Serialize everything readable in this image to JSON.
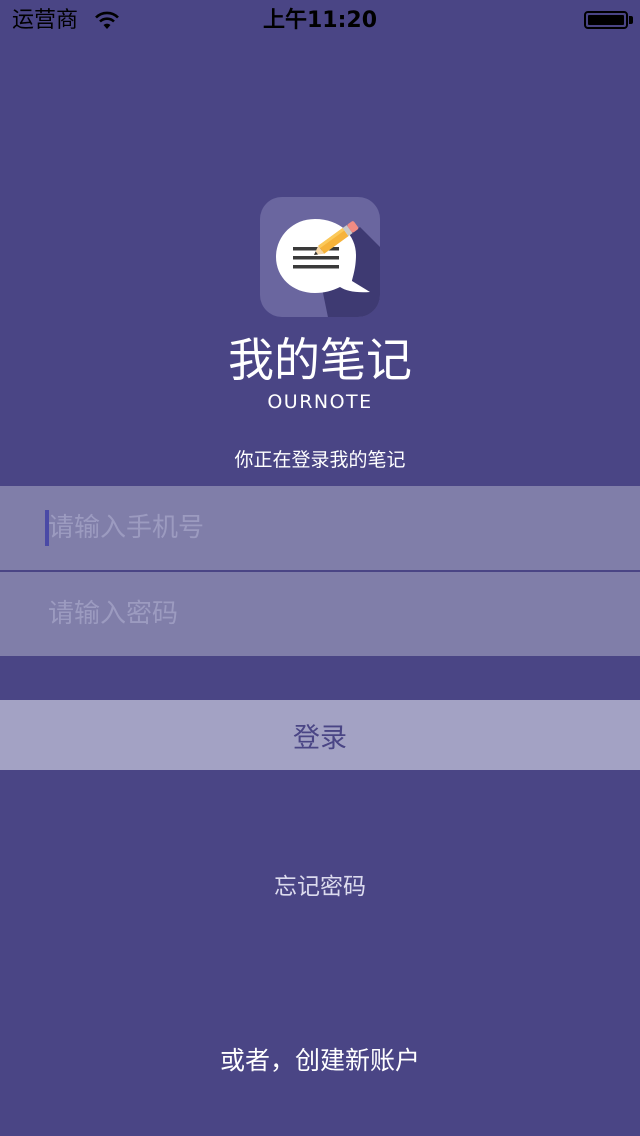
{
  "status_bar": {
    "carrier": "运营商",
    "time": "上午11:20"
  },
  "app": {
    "title": "我的笔记",
    "subtitle": "OURNOTE",
    "login_hint": "你正在登录我的笔记"
  },
  "form": {
    "phone_placeholder": "请输入手机号",
    "phone_value": "",
    "password_placeholder": "请输入密码",
    "password_value": "",
    "login_label": "登录"
  },
  "links": {
    "forgot_password": "忘记密码",
    "create_account": "或者，创建新账户"
  },
  "colors": {
    "background": "#4a4585",
    "field": "#807ea9",
    "button": "#a3a2c4"
  }
}
